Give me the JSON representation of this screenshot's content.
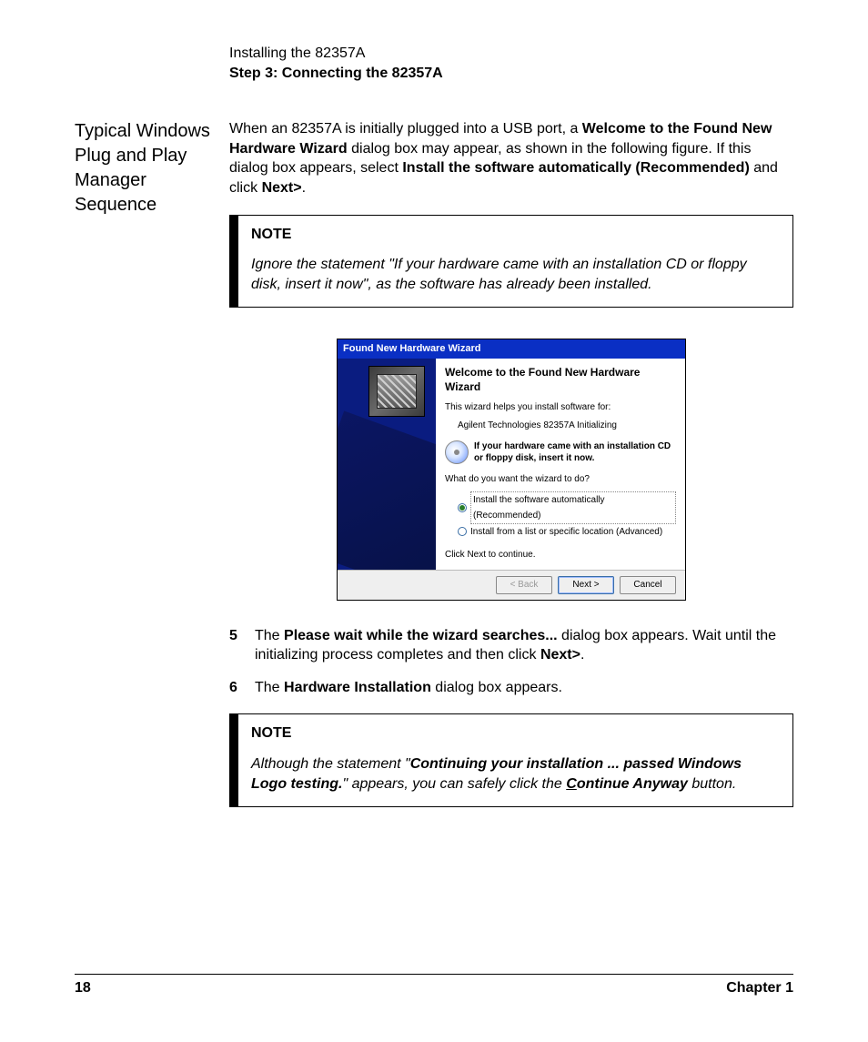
{
  "header": {
    "line1": "Installing the 82357A",
    "line2": "Step 3: Connecting the 82357A"
  },
  "sideHeading": "Typical Windows Plug and Play Manager Sequence",
  "intro": {
    "p1a": "When an 82357A is initially plugged into a USB port, a ",
    "p1b": "Welcome to the Found New Hardware Wizard",
    "p1c": " dialog box may appear, as shown in the following figure. If this dialog box appears, select  ",
    "p1d": "Install the software automatically (Recommended)",
    "p1e": " and click ",
    "p1f": "Next>",
    "p1g": "."
  },
  "note1": {
    "title": "NOTE",
    "body": "Ignore the statement \"If your hardware came with an installation CD or floppy disk, insert it now\", as the software has already been installed."
  },
  "wizard": {
    "title": "Found New Hardware Wizard",
    "heading": "Welcome to the Found New Hardware Wizard",
    "line1": "This wizard helps you install software for:",
    "line2": "Agilent Technologies 82357A Initializing",
    "cdText": "If your hardware came with an installation CD or floppy disk, insert it now.",
    "question": "What do you want the wizard to do?",
    "opt1": "Install the software automatically (Recommended)",
    "opt2": "Install from a list or specific location (Advanced)",
    "continue": "Click Next to continue.",
    "buttons": {
      "back": "< Back",
      "next": "Next >",
      "cancel": "Cancel"
    }
  },
  "steps": {
    "n5": "5",
    "s5a": "The ",
    "s5b": "Please wait while the wizard searches...",
    "s5c": " dialog box appears. Wait until the initializing process completes and then click ",
    "s5d": "Next>",
    "s5e": ".",
    "n6": "6",
    "s6a": "The ",
    "s6b": "Hardware Installation",
    "s6c": " dialog box appears."
  },
  "note2": {
    "title": "NOTE",
    "a": "Although the statement \"",
    "b": "Continuing your installation ... passed Windows Logo testing.",
    "c": "\" appears, you can safely click the ",
    "d_pre": "C",
    "d": "ontinue Anyway",
    "e": " button."
  },
  "footer": {
    "page": "18",
    "chapter": "Chapter 1"
  }
}
